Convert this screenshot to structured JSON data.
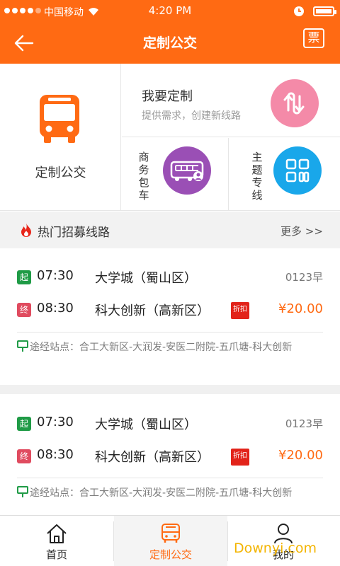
{
  "status": {
    "carrier": "中国移动",
    "time": "4:20 PM"
  },
  "nav": {
    "title": "定制公交",
    "ticket": "票"
  },
  "cards": {
    "bus_label": "定制公交",
    "custom_title": "我要定制",
    "custom_sub": "提供需求，创建新线路",
    "charter_label": [
      "商",
      "务",
      "包",
      "车"
    ],
    "theme_label": [
      "主",
      "题",
      "专",
      "线"
    ]
  },
  "section": {
    "title": "热门招募线路",
    "more": "更多 >>"
  },
  "routes": [
    {
      "start_badge": "起",
      "start_time": "07:30",
      "start_station": "大学城（蜀山区）",
      "code": "0123早",
      "end_badge": "终",
      "end_time": "08:30",
      "end_station": "科大创新（高新区）",
      "discount": "折扣",
      "price": "¥20.00",
      "stops": "途经站点：合工大新区-大润发-安医二附院-五爪塘-科大创新"
    },
    {
      "start_badge": "起",
      "start_time": "07:30",
      "start_station": "大学城（蜀山区）",
      "code": "0123早",
      "end_badge": "终",
      "end_time": "08:30",
      "end_station": "科大创新（高新区）",
      "discount": "折扣",
      "price": "¥20.00",
      "stops": "途经站点：合工大新区-大润发-安医二附院-五爪塘-科大创新"
    }
  ],
  "tabs": [
    {
      "label": "首页",
      "icon": "home-icon"
    },
    {
      "label": "定制公交",
      "icon": "bus-icon"
    },
    {
      "label": "我的",
      "icon": "user-icon"
    }
  ],
  "watermark": "Downyi.com",
  "colors": {
    "accent": "#ff6a13",
    "pink": "#f48aa8",
    "purple": "#9a4fb5",
    "blue": "#19a7ea",
    "green": "#1f9b46",
    "red": "#e04b5f"
  }
}
